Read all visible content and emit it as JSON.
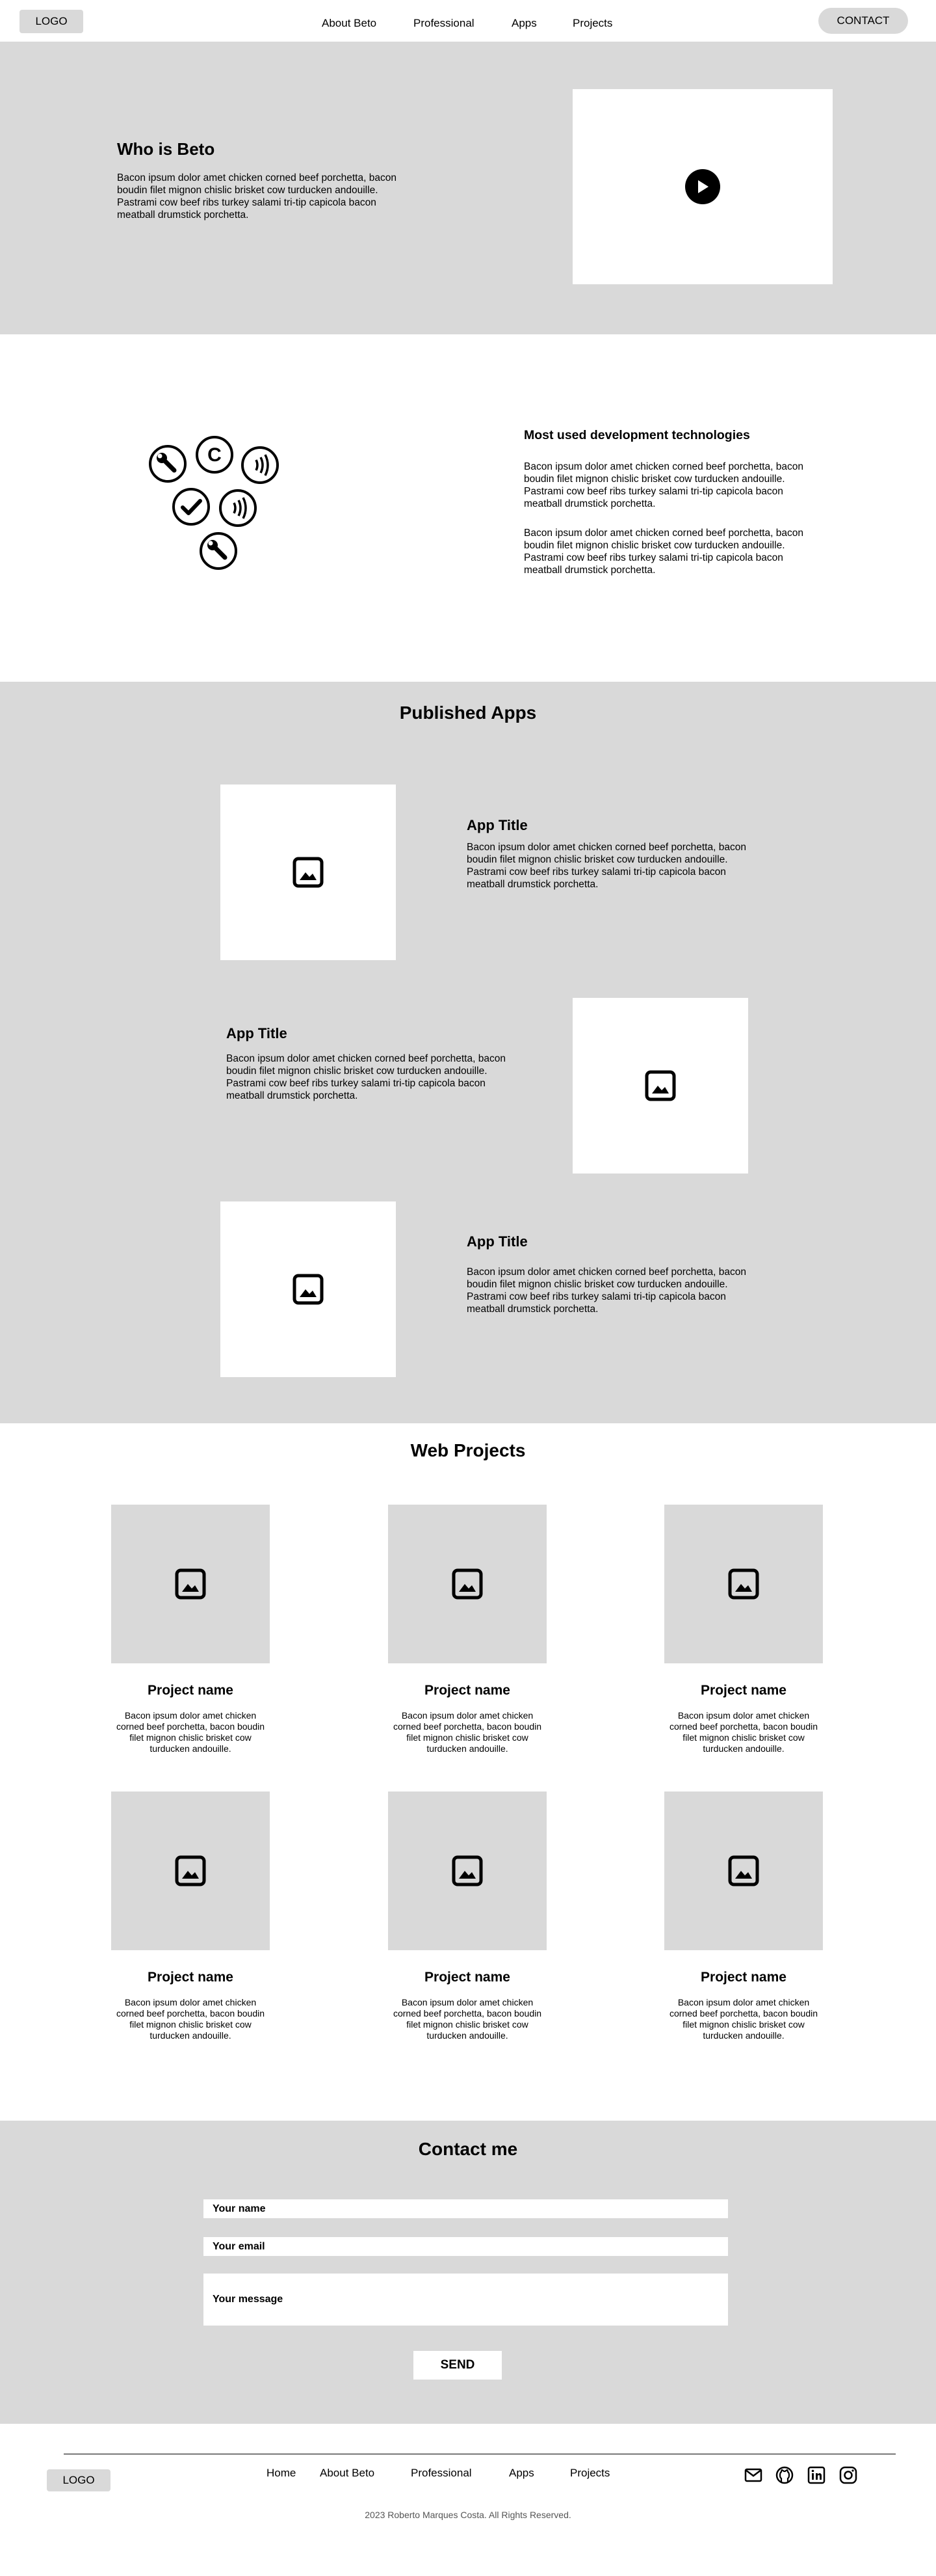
{
  "header": {
    "logo": "LOGO",
    "nav": [
      "About Beto",
      "Professional",
      "Apps",
      "Projects"
    ],
    "contact": "CONTACT"
  },
  "hero": {
    "title": "Who is Beto",
    "text": "Bacon ipsum dolor amet chicken corned beef porchetta, bacon boudin filet mignon chislic brisket cow turducken andouille. Pastrami cow beef ribs turkey salami tri-tip capicola bacon meatball drumstick porchetta.",
    "video_icon": "play-icon"
  },
  "tech": {
    "title": "Most used development technologies",
    "paragraphs": [
      "Bacon ipsum dolor amet chicken corned beef porchetta, bacon boudin filet mignon chislic brisket cow turducken andouille. Pastrami cow beef ribs turkey salami tri-tip capicola bacon meatball drumstick porchetta.",
      "Bacon ipsum dolor amet chicken corned beef porchetta, bacon boudin filet mignon chislic brisket cow turducken andouille. Pastrami cow beef ribs turkey salami tri-tip capicola bacon meatball drumstick porchetta."
    ],
    "icons": [
      "wrench-icon",
      "copyright-icon",
      "contactless-icon",
      "check-icon",
      "contactless-icon",
      "wrench-icon"
    ]
  },
  "apps": {
    "title": "Published Apps",
    "items": [
      {
        "title": "App Title",
        "text": "Bacon ipsum dolor amet chicken corned beef porchetta, bacon boudin filet mignon chislic brisket cow turducken andouille. Pastrami cow beef ribs turkey salami tri-tip capicola bacon meatball drumstick porchetta."
      },
      {
        "title": "App Title",
        "text": "Bacon ipsum dolor amet chicken corned beef porchetta, bacon boudin filet mignon chislic brisket cow turducken andouille. Pastrami cow beef ribs turkey salami tri-tip capicola bacon meatball drumstick porchetta."
      },
      {
        "title": "App Title",
        "text": "Bacon ipsum dolor amet chicken corned beef porchetta, bacon boudin filet mignon chislic brisket cow turducken andouille. Pastrami cow beef ribs turkey salami tri-tip capicola bacon meatball drumstick porchetta."
      }
    ]
  },
  "projects": {
    "title": "Web Projects",
    "items": [
      {
        "name": "Project name",
        "desc": "Bacon ipsum dolor amet chicken corned beef porchetta, bacon boudin filet mignon chislic brisket cow turducken andouille."
      },
      {
        "name": "Project name",
        "desc": "Bacon ipsum dolor amet chicken corned beef porchetta, bacon boudin filet mignon chislic brisket cow turducken andouille."
      },
      {
        "name": "Project name",
        "desc": "Bacon ipsum dolor amet chicken corned beef porchetta, bacon boudin filet mignon chislic brisket cow turducken andouille."
      },
      {
        "name": "Project name",
        "desc": "Bacon ipsum dolor amet chicken corned beef porchetta, bacon boudin filet mignon chislic brisket cow turducken andouille."
      },
      {
        "name": "Project name",
        "desc": "Bacon ipsum dolor amet chicken corned beef porchetta, bacon boudin filet mignon chislic brisket cow turducken andouille."
      },
      {
        "name": "Project name",
        "desc": "Bacon ipsum dolor amet chicken corned beef porchetta, bacon boudin filet mignon chislic brisket cow turducken andouille."
      }
    ]
  },
  "contact": {
    "title": "Contact me",
    "name_label": "Your name",
    "email_label": "Your email",
    "message_label": "Your message",
    "send": "SEND"
  },
  "footer": {
    "logo": "LOGO",
    "nav": [
      "Home",
      "About Beto",
      "Professional",
      "Apps",
      "Projects"
    ],
    "social_icons": [
      "mail-icon",
      "github-icon",
      "linkedin-icon",
      "instagram-icon"
    ],
    "copyright": "2023 Roberto Marques Costa. All Rights Reserved."
  },
  "colors": {
    "section_gray": "#d9d9d9",
    "background": "#ffffff",
    "text": "#000000"
  }
}
